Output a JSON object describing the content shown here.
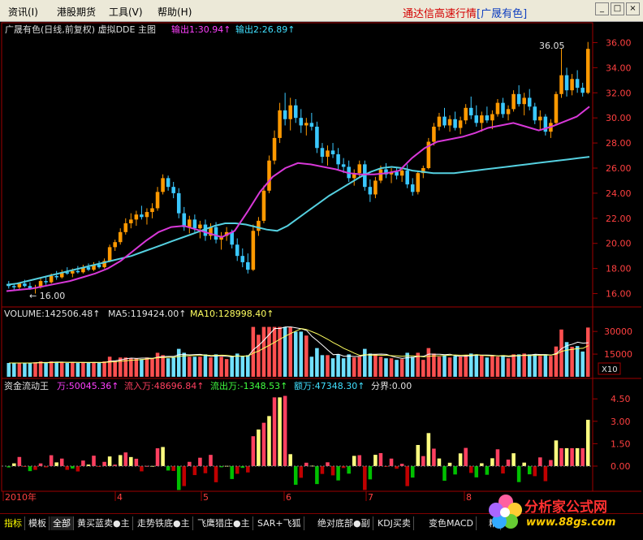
{
  "menu": {
    "items": [
      "资讯(I)",
      "港股期货",
      "工具(V)",
      "帮助(H)"
    ],
    "quote_title": "通达信高速行情",
    "quote_stock": "[广晟有色]",
    "win": {
      "min": "_",
      "max": "□",
      "close": "×"
    }
  },
  "main": {
    "title": "广晟有色(日线,前复权) 虚拟DDE 主图",
    "out1": "输出1:30.94↑",
    "out2": "输出2:26.89↑",
    "high_label": "36.05",
    "low_label": "← 16.00",
    "yticks": [
      16,
      18,
      20,
      22,
      24,
      26,
      28,
      30,
      32,
      34,
      36
    ],
    "ytick_labels": [
      "16.00",
      "18.00",
      "20.00",
      "22.00",
      "24.00",
      "26.00",
      "28.00",
      "30.00",
      "32.00",
      "34.00",
      "36.00"
    ]
  },
  "volume": {
    "vol": "VOLUME:142506.48↑",
    "ma5": "MA5:119424.00↑",
    "ma10": "MA10:128998.40↑",
    "ytick_labels": [
      "30000",
      "15000"
    ],
    "yticks": [
      30000,
      15000
    ],
    "unit": "X10"
  },
  "money": {
    "title": "资金流动王",
    "wan": "万:50045.36↑",
    "inflow": "流入万:48696.84↑",
    "outflow": "流出万:-1348.53↑",
    "amount": "额万:47348.30↑",
    "divider": "分界:0.00",
    "yticks": [
      4.5,
      3.0,
      1.5,
      0.0
    ],
    "ytick_labels": [
      "4.50",
      "3.00",
      "1.50",
      "0.00"
    ]
  },
  "xaxis": {
    "labels": [
      "2010年",
      "4",
      "5",
      "6",
      "7",
      "8"
    ]
  },
  "tabs": [
    {
      "label": "指标",
      "state": "active"
    },
    {
      "label": "模板",
      "state": "normal"
    },
    {
      "label": "全部",
      "state": "sel"
    },
    {
      "label": "黄买蓝卖●主",
      "state": "normal"
    },
    {
      "label": "走势铁底●主",
      "state": "normal"
    },
    {
      "label": "飞鹰猎庄●主",
      "state": "normal"
    },
    {
      "label": "SAR+飞狐",
      "state": "normal"
    },
    {
      "label": "绝对底部●副",
      "state": "normal"
    },
    {
      "label": "KDJ买卖",
      "state": "normal"
    },
    {
      "label": "变色MACD",
      "state": "normal"
    },
    {
      "label": "精",
      "state": "normal"
    }
  ],
  "logo": {
    "name": "分析家公式网",
    "url": "www.88gs.com"
  },
  "colors": {
    "bull": "#ff9900",
    "bull_bright": "#ffcc00",
    "bear": "#3ac8ff",
    "ma_long": "#55d0e0",
    "ma_short": "#d838d8",
    "vol_up": "#ff5050",
    "vol_dn": "#70e0ff",
    "flow_red": "#ff4060",
    "flow_yellow": "#ffff80",
    "flow_green": "#00c000",
    "flow_darkred": "#c00000",
    "axis": "#a00000",
    "grid": "#600000"
  },
  "chart_data": {
    "type": "candlestick",
    "candles_ohlc": [
      [
        16.7,
        17.0,
        16.4,
        16.6
      ],
      [
        16.6,
        16.8,
        16.2,
        16.5
      ],
      [
        16.5,
        16.9,
        16.3,
        16.8
      ],
      [
        16.8,
        17.1,
        16.5,
        16.6
      ],
      [
        16.6,
        16.9,
        16.3,
        16.4
      ],
      [
        16.4,
        16.7,
        16.0,
        16.5
      ],
      [
        16.5,
        17.2,
        16.4,
        17.0
      ],
      [
        17.0,
        17.3,
        16.7,
        16.9
      ],
      [
        16.9,
        17.6,
        16.8,
        17.4
      ],
      [
        17.4,
        17.8,
        17.1,
        17.3
      ],
      [
        17.3,
        17.9,
        17.2,
        17.7
      ],
      [
        17.7,
        18.1,
        17.5,
        17.6
      ],
      [
        17.6,
        18.0,
        17.3,
        17.8
      ],
      [
        17.8,
        18.2,
        17.6,
        17.7
      ],
      [
        17.7,
        18.3,
        17.6,
        18.1
      ],
      [
        18.1,
        18.4,
        17.8,
        17.9
      ],
      [
        17.9,
        18.5,
        17.8,
        18.3
      ],
      [
        18.3,
        18.6,
        18.0,
        18.1
      ],
      [
        18.1,
        18.8,
        18.0,
        18.6
      ],
      [
        18.6,
        19.9,
        18.5,
        19.7
      ],
      [
        19.7,
        20.3,
        19.4,
        20.1
      ],
      [
        20.1,
        21.2,
        19.9,
        20.9
      ],
      [
        20.9,
        22.0,
        20.7,
        21.6
      ],
      [
        21.6,
        22.4,
        21.2,
        21.9
      ],
      [
        21.9,
        22.6,
        21.4,
        22.3
      ],
      [
        22.3,
        23.0,
        21.9,
        22.1
      ],
      [
        22.1,
        22.8,
        21.5,
        22.5
      ],
      [
        22.5,
        23.2,
        22.0,
        22.8
      ],
      [
        22.8,
        24.5,
        22.6,
        24.1
      ],
      [
        24.1,
        25.5,
        23.9,
        25.2
      ],
      [
        25.2,
        25.4,
        24.2,
        24.5
      ],
      [
        24.5,
        24.9,
        23.6,
        24.0
      ],
      [
        24.0,
        24.4,
        22.0,
        22.4
      ],
      [
        22.4,
        22.9,
        21.0,
        21.3
      ],
      [
        21.3,
        22.2,
        20.8,
        21.9
      ],
      [
        21.9,
        22.3,
        20.9,
        21.2
      ],
      [
        21.2,
        21.8,
        20.4,
        21.5
      ],
      [
        21.5,
        21.9,
        20.2,
        20.6
      ],
      [
        20.6,
        21.6,
        20.3,
        21.3
      ],
      [
        21.3,
        21.7,
        20.0,
        20.3
      ],
      [
        20.3,
        20.9,
        19.5,
        20.6
      ],
      [
        20.6,
        21.3,
        20.2,
        20.9
      ],
      [
        20.9,
        21.1,
        19.6,
        19.9
      ],
      [
        19.9,
        20.4,
        18.6,
        19.0
      ],
      [
        19.0,
        19.6,
        18.1,
        18.5
      ],
      [
        18.5,
        19.2,
        17.6,
        17.9
      ],
      [
        17.9,
        21.5,
        17.8,
        21.0
      ],
      [
        21.0,
        22.1,
        20.6,
        21.8
      ],
      [
        21.8,
        24.6,
        21.6,
        24.2
      ],
      [
        24.2,
        27.0,
        24.0,
        26.6
      ],
      [
        26.6,
        29.0,
        26.3,
        28.4
      ],
      [
        28.4,
        31.2,
        28.0,
        30.6
      ],
      [
        30.6,
        32.0,
        29.4,
        29.9
      ],
      [
        29.9,
        31.6,
        29.0,
        31.0
      ],
      [
        31.0,
        31.5,
        29.6,
        30.0
      ],
      [
        30.0,
        30.7,
        28.8,
        29.4
      ],
      [
        29.4,
        30.0,
        28.6,
        29.6
      ],
      [
        29.6,
        30.4,
        29.0,
        29.3
      ],
      [
        29.3,
        29.7,
        27.2,
        27.6
      ],
      [
        27.6,
        28.0,
        26.4,
        26.9
      ],
      [
        26.9,
        27.8,
        26.2,
        27.4
      ],
      [
        27.4,
        28.0,
        26.8,
        27.1
      ],
      [
        27.1,
        27.6,
        25.9,
        26.3
      ],
      [
        26.3,
        26.8,
        25.6,
        26.1
      ],
      [
        26.1,
        26.6,
        24.9,
        25.2
      ],
      [
        25.2,
        25.9,
        24.6,
        25.6
      ],
      [
        25.6,
        26.6,
        25.2,
        26.3
      ],
      [
        26.3,
        26.6,
        24.2,
        24.5
      ],
      [
        24.5,
        25.1,
        23.3,
        23.9
      ],
      [
        23.9,
        25.3,
        23.6,
        25.0
      ],
      [
        25.0,
        26.2,
        24.8,
        25.9
      ],
      [
        25.9,
        26.4,
        25.2,
        25.5
      ],
      [
        25.5,
        26.0,
        24.8,
        25.7
      ],
      [
        25.7,
        26.1,
        25.1,
        25.4
      ],
      [
        25.4,
        26.0,
        24.9,
        25.8
      ],
      [
        25.8,
        26.3,
        24.4,
        24.7
      ],
      [
        24.7,
        25.2,
        23.8,
        24.1
      ],
      [
        24.1,
        25.8,
        23.9,
        25.6
      ],
      [
        25.6,
        26.2,
        25.2,
        26.0
      ],
      [
        26.0,
        28.4,
        25.9,
        28.1
      ],
      [
        28.1,
        29.6,
        27.8,
        29.3
      ],
      [
        29.3,
        30.4,
        29.0,
        30.1
      ],
      [
        30.1,
        30.8,
        29.2,
        29.4
      ],
      [
        29.4,
        30.2,
        28.9,
        29.9
      ],
      [
        29.9,
        30.5,
        29.0,
        29.2
      ],
      [
        29.2,
        30.1,
        28.7,
        29.8
      ],
      [
        29.8,
        31.1,
        29.5,
        30.8
      ],
      [
        30.8,
        31.7,
        29.9,
        30.2
      ],
      [
        30.2,
        31.0,
        29.3,
        29.6
      ],
      [
        29.6,
        30.5,
        28.9,
        30.2
      ],
      [
        30.2,
        30.9,
        29.6,
        29.8
      ],
      [
        29.8,
        30.6,
        29.1,
        30.3
      ],
      [
        30.3,
        31.5,
        30.1,
        31.2
      ],
      [
        31.2,
        31.6,
        30.0,
        30.3
      ],
      [
        30.3,
        31.0,
        29.8,
        30.7
      ],
      [
        30.7,
        32.2,
        30.5,
        31.9
      ],
      [
        31.9,
        32.6,
        30.9,
        31.1
      ],
      [
        31.1,
        32.0,
        30.2,
        31.6
      ],
      [
        31.6,
        32.3,
        30.6,
        30.9
      ],
      [
        30.9,
        31.2,
        29.5,
        29.8
      ],
      [
        29.8,
        30.6,
        29.1,
        30.1
      ],
      [
        30.1,
        30.3,
        28.6,
        28.9
      ],
      [
        28.9,
        29.9,
        28.4,
        29.6
      ],
      [
        29.6,
        32.1,
        29.4,
        31.9
      ],
      [
        31.9,
        35.5,
        31.6,
        33.4
      ],
      [
        33.4,
        34.0,
        31.7,
        32.2
      ],
      [
        32.2,
        33.5,
        31.8,
        33.1
      ],
      [
        33.1,
        33.8,
        32.0,
        32.4
      ],
      [
        32.4,
        32.8,
        31.7,
        32.0
      ],
      [
        32.0,
        36.05,
        31.9,
        35.5
      ]
    ],
    "ma_long": [
      16.7,
      16.8,
      17.0,
      17.2,
      17.4,
      17.6,
      17.8,
      18.0,
      18.2,
      18.4,
      18.6,
      18.8,
      19.0,
      19.3,
      19.6,
      19.9,
      20.2,
      20.5,
      20.8,
      21.1,
      21.4,
      21.6,
      21.6,
      21.5,
      21.3,
      21.1,
      21.0,
      21.4,
      22.0,
      22.6,
      23.2,
      23.8,
      24.3,
      24.8,
      25.3,
      25.7,
      26.0,
      26.1,
      26.0,
      25.8,
      25.7,
      25.6,
      25.6,
      25.6,
      25.7,
      25.8,
      25.9,
      26.0,
      26.1,
      26.2,
      26.3,
      26.4,
      26.5,
      26.6,
      26.7,
      26.8,
      26.9
    ],
    "ma_short": [
      16.2,
      16.3,
      16.4,
      16.6,
      16.8,
      17.0,
      17.3,
      17.6,
      18.0,
      18.6,
      19.4,
      20.2,
      20.9,
      21.3,
      21.4,
      21.1,
      20.8,
      20.5,
      21.0,
      22.5,
      24.1,
      25.3,
      26.0,
      26.4,
      26.3,
      26.1,
      25.9,
      25.6,
      25.5,
      25.5,
      25.6,
      25.8,
      26.8,
      27.6,
      28.1,
      28.3,
      28.5,
      28.8,
      29.2,
      29.4,
      29.6,
      29.3,
      29.0,
      29.3,
      29.7,
      30.1,
      30.9
    ]
  }
}
